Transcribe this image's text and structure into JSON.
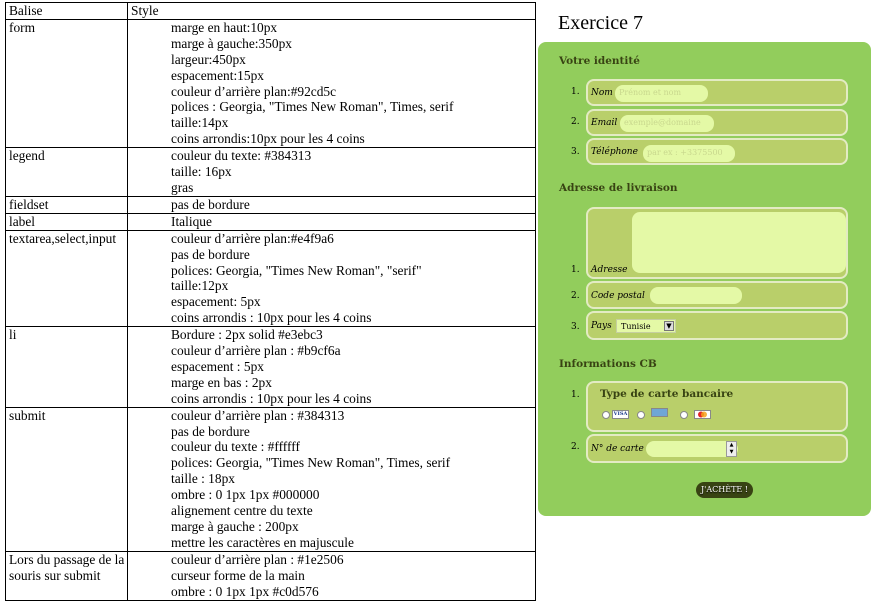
{
  "table": {
    "headers": [
      "Balise",
      "Style"
    ],
    "rows": [
      {
        "tag": "form",
        "styles": [
          "marge en haut:10px",
          "marge à gauche:350px",
          "largeur:450px",
          "espacement:15px",
          "couleur d’arrière plan:#92cd5c",
          "polices : Georgia, \"Times New Roman\", Times, serif",
          "taille:14px",
          "coins arrondis:10px pour les 4 coins"
        ]
      },
      {
        "tag": "legend",
        "styles": [
          "couleur du texte: #384313",
          "taille: 16px",
          "gras"
        ]
      },
      {
        "tag": "fieldset",
        "styles": [
          "pas de bordure"
        ]
      },
      {
        "tag": "label",
        "styles": [
          "Italique"
        ]
      },
      {
        "tag": "textarea,select,input",
        "styles": [
          "couleur d’arrière plan:#e4f9a6",
          "pas de bordure",
          "polices: Georgia, \"Times New Roman\", \"serif\"",
          "taille:12px",
          "espacement: 5px",
          "coins arrondis : 10px pour les 4 coins"
        ]
      },
      {
        "tag": "li",
        "styles": [
          "Bordure : 2px solid #e3ebc3",
          "couleur d’arrière plan : #b9cf6a",
          "espacement : 5px",
          "marge en bas : 2px",
          "coins arrondis : 10px pour les 4 coins"
        ]
      },
      {
        "tag": "submit",
        "styles": [
          "couleur d’arrière plan : #384313",
          "pas de bordure",
          "couleur du texte : #ffffff",
          "polices: Georgia, \"Times New Roman\", Times, serif",
          "taille : 18px",
          "ombre : 0 1px 1px #000000",
          "alignement centre du texte",
          "marge à gauche : 200px",
          "mettre les caractères en majuscule"
        ]
      },
      {
        "tag": "Lors du passage de la souris sur submit",
        "styles": [
          "couleur d’arrière plan : #1e2506",
          "curseur forme de la main",
          "ombre : 0 1px 1px #c0d576"
        ]
      }
    ]
  },
  "exercise_title": "Exercice 7",
  "form": {
    "colors": {
      "form_bg": "#92cd5c",
      "legend": "#384313",
      "li_bg": "#b9cf6a",
      "li_border": "#e3ebc3",
      "input_bg": "#e4f9a6",
      "submit_bg": "#384313"
    },
    "identity": {
      "legend": "Votre identité",
      "nom": {
        "num": "1.",
        "label": "Nom",
        "placeholder": "Prénom et nom"
      },
      "email": {
        "num": "2.",
        "label": "Email",
        "placeholder": "exemple@domaine"
      },
      "tel": {
        "num": "3.",
        "label": "Téléphone",
        "placeholder": "par ex : +3375500"
      }
    },
    "delivery": {
      "legend": "Adresse de livraison",
      "adresse": {
        "num": "1.",
        "label": "Adresse"
      },
      "code": {
        "num": "2.",
        "label": "Code postal"
      },
      "pays": {
        "num": "3.",
        "label": "Pays",
        "selected": "Tunisie"
      }
    },
    "payment": {
      "legend": "Informations CB",
      "card_type": {
        "num": "1.",
        "title": "Type de carte bancaire",
        "options": [
          "VISA",
          "AmEx",
          "MasterCard"
        ]
      },
      "card_number": {
        "num": "2.",
        "label": "N° de carte"
      }
    },
    "submit_label": "J'achète !"
  }
}
